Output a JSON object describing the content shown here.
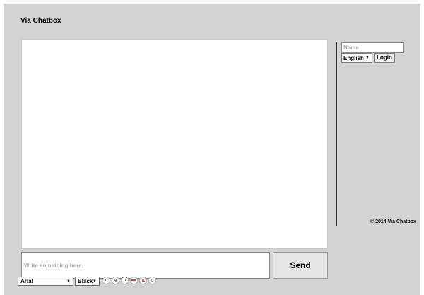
{
  "app": {
    "title": "Via Chatbox"
  },
  "sidebar": {
    "name_placeholder": "Name",
    "name_value": "",
    "language": {
      "selected": "English"
    },
    "login_label": "Login",
    "copyright": "© 2014 Via Chatbox"
  },
  "composer": {
    "message_placeholder": "Write something here.",
    "message_value": "",
    "send_label": "Send",
    "font": {
      "selected": "Arial"
    },
    "color": {
      "selected": "Black"
    },
    "emoticons": [
      {
        "icon": "smile-emoticon-icon"
      },
      {
        "icon": "sad-emoticon-icon"
      },
      {
        "icon": "surprised-emoticon-icon"
      },
      {
        "icon": "cool-emoticon-icon"
      },
      {
        "icon": "tongue-emoticon-icon"
      },
      {
        "icon": "kiss-emoticon-icon"
      }
    ]
  },
  "colors": {
    "frame_background": "#d3d3d3",
    "panel_background": "#ffffff",
    "placeholder_text": "#aaaaaa"
  }
}
